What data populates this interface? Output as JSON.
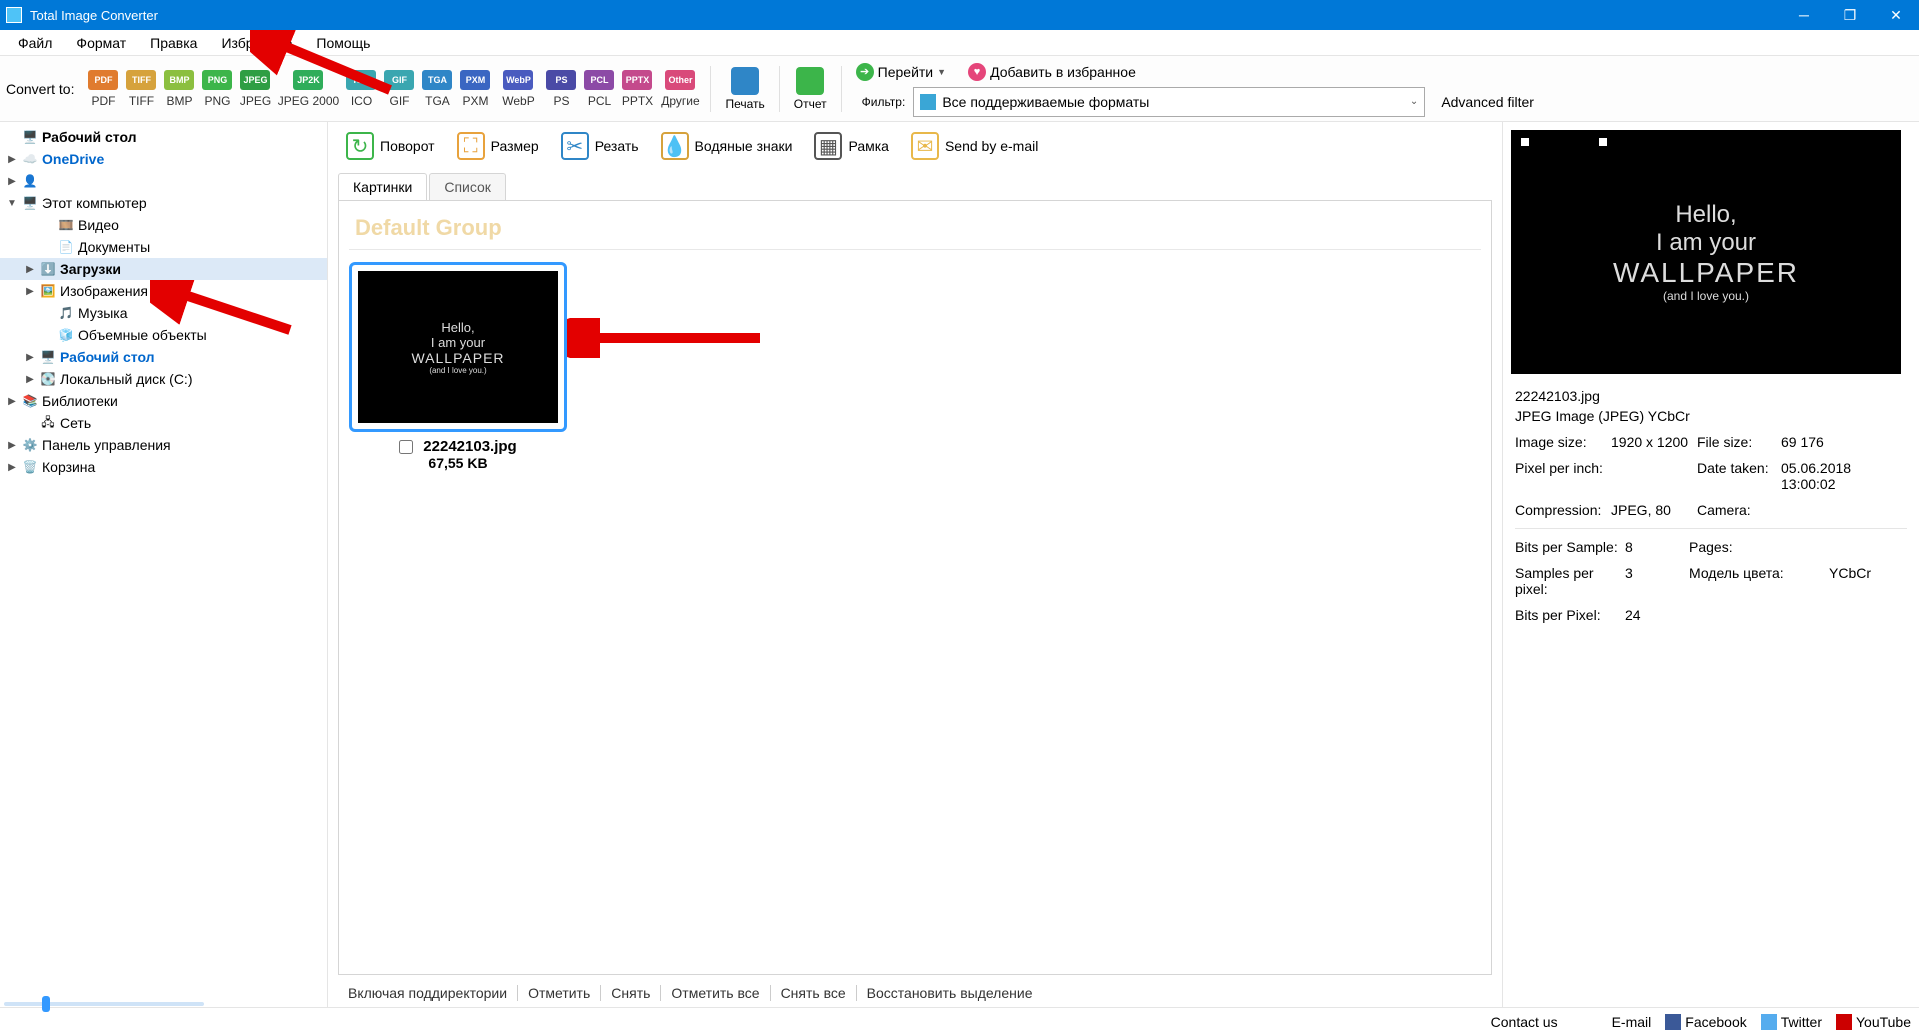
{
  "title": "Total Image Converter",
  "menus": [
    "Файл",
    "Формат",
    "Правка",
    "Избранное",
    "Помощь"
  ],
  "convert_label": "Convert to:",
  "formats": [
    {
      "label": "PDF",
      "bg": "#e07b2e"
    },
    {
      "label": "TIFF",
      "bg": "#d6a23c"
    },
    {
      "label": "BMP",
      "bg": "#8bbf3f"
    },
    {
      "label": "PNG",
      "bg": "#3cb54a"
    },
    {
      "label": "JPEG",
      "bg": "#2f9e44"
    },
    {
      "label": "JPEG 2000",
      "bg": "#2fad5a",
      "wide": true,
      "badge": "JP2K"
    },
    {
      "label": "ICO",
      "bg": "#3aa6b0"
    },
    {
      "label": "GIF",
      "bg": "#3aa6b0"
    },
    {
      "label": "TGA",
      "bg": "#2f86c7"
    },
    {
      "label": "PXM",
      "bg": "#3a66c2"
    },
    {
      "label": "WebP",
      "bg": "#4a5bbf",
      "med": true
    },
    {
      "label": "PS",
      "bg": "#4a4aa6"
    },
    {
      "label": "PCL",
      "bg": "#8c4aa6"
    },
    {
      "label": "PPTX",
      "bg": "#c44a8c"
    },
    {
      "label": "Другие",
      "bg": "#d94a7a",
      "med": true,
      "badge": "Other",
      "dropdown": true
    }
  ],
  "print_label": "Печать",
  "report_label": "Отчет",
  "goto_label": "Перейти",
  "addfav_label": "Добавить в избранное",
  "filter_label": "Фильтр:",
  "filter_value": "Все поддерживаемые форматы",
  "adv_filter": "Advanced filter",
  "tree": [
    {
      "indent": 0,
      "caret": "",
      "icon": "🖥️",
      "label": "Рабочий стол",
      "bold": true
    },
    {
      "indent": 0,
      "caret": "▶",
      "icon": "☁️",
      "label": "OneDrive",
      "blue": true
    },
    {
      "indent": 0,
      "caret": "▶",
      "icon": "👤",
      "label": ""
    },
    {
      "indent": 0,
      "caret": "▼",
      "icon": "🖥️",
      "label": "Этот компьютер"
    },
    {
      "indent": 2,
      "caret": "",
      "icon": "🎞️",
      "label": "Видео"
    },
    {
      "indent": 2,
      "caret": "",
      "icon": "📄",
      "label": "Документы"
    },
    {
      "indent": 1,
      "caret": "▶",
      "icon": "⬇️",
      "label": "Загрузки",
      "selected": true
    },
    {
      "indent": 1,
      "caret": "▶",
      "icon": "🖼️",
      "label": "Изображения"
    },
    {
      "indent": 2,
      "caret": "",
      "icon": "🎵",
      "label": "Музыка"
    },
    {
      "indent": 2,
      "caret": "",
      "icon": "🧊",
      "label": "Объемные объекты"
    },
    {
      "indent": 1,
      "caret": "▶",
      "icon": "🖥️",
      "label": "Рабочий стол",
      "blue": true
    },
    {
      "indent": 1,
      "caret": "▶",
      "icon": "💽",
      "label": "Локальный диск (C:)"
    },
    {
      "indent": 0,
      "caret": "▶",
      "icon": "📚",
      "label": "Библиотеки"
    },
    {
      "indent": 1,
      "caret": "",
      "icon": "🖧",
      "label": "Сеть"
    },
    {
      "indent": 0,
      "caret": "▶",
      "icon": "⚙️",
      "label": "Панель управления"
    },
    {
      "indent": 0,
      "caret": "▶",
      "icon": "🗑️",
      "label": "Корзина"
    }
  ],
  "tools": [
    {
      "label": "Поворот",
      "color": "#3cb54a"
    },
    {
      "label": "Размер",
      "color": "#e8a23c"
    },
    {
      "label": "Резать",
      "color": "#2f86c7"
    },
    {
      "label": "Водяные знаки",
      "color": "#d6a23c"
    },
    {
      "label": "Рамка",
      "color": "#555"
    },
    {
      "label": "Send by e-mail",
      "color": "#e8b84a"
    }
  ],
  "tabs": {
    "pictures": "Картинки",
    "list": "Список"
  },
  "group_header": "Default Group",
  "thumb": {
    "name": "22242103.jpg",
    "size": "67,55 KB",
    "text1": "Hello,",
    "text2": "I am your",
    "text3": "WALLPAPER",
    "text4": "(and I love you.)"
  },
  "listbar": [
    "Включая поддиректории",
    "Отметить",
    "Снять",
    "Отметить все",
    "Снять все",
    "Восстановить выделение"
  ],
  "details": {
    "filename": "22242103.jpg",
    "type": "JPEG Image (JPEG) YCbCr",
    "rows1": [
      [
        "Image size:",
        "1920 x 1200",
        "File size:",
        "69 176"
      ],
      [
        "Pixel per inch:",
        "",
        "Date taken:",
        "05.06.2018 13:00:02"
      ],
      [
        "Compression:",
        "JPEG, 80",
        "Camera:",
        ""
      ]
    ],
    "rows2": [
      [
        "Bits per Sample:",
        "8",
        "Pages:",
        ""
      ],
      [
        "Samples per pixel:",
        "3",
        "Модель цвета:",
        "YCbCr"
      ],
      [
        "Bits per Pixel:",
        "24",
        "",
        ""
      ]
    ]
  },
  "status": {
    "contact": "Contact us",
    "email": "E-mail",
    "fb": "Facebook",
    "tw": "Twitter",
    "yt": "YouTube"
  }
}
